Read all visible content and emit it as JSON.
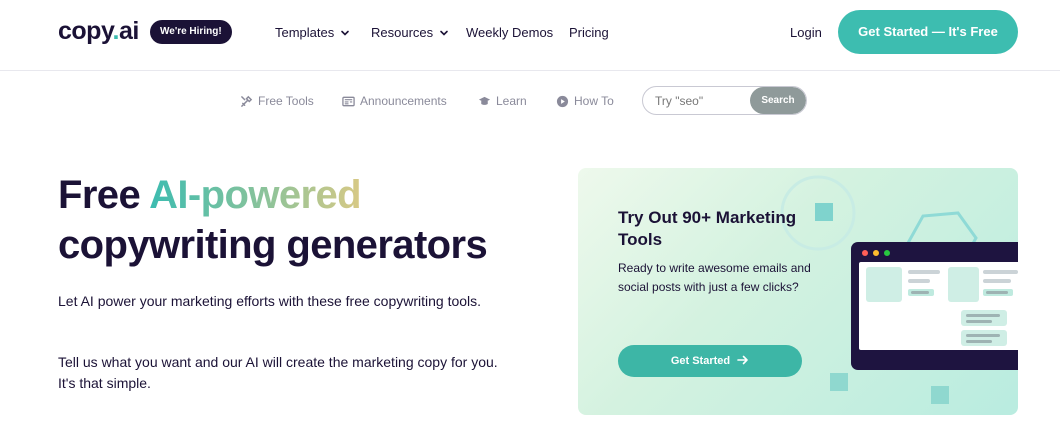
{
  "header": {
    "logo_main": "copy",
    "logo_dot": ".",
    "logo_ai": "ai",
    "hiring_badge": "We're Hiring!",
    "nav": [
      {
        "label": "Templates",
        "has_dropdown": true
      },
      {
        "label": "Resources",
        "has_dropdown": true
      },
      {
        "label": "Weekly Demos",
        "has_dropdown": false
      },
      {
        "label": "Pricing",
        "has_dropdown": false
      }
    ],
    "login_label": "Login",
    "cta_label": "Get Started — It's Free"
  },
  "subnav": {
    "items": [
      {
        "label": "Free Tools",
        "icon": "tools-icon"
      },
      {
        "label": "Announcements",
        "icon": "newspaper-icon"
      },
      {
        "label": "Learn",
        "icon": "graduation-cap-icon"
      },
      {
        "label": "How To",
        "icon": "play-circle-icon"
      }
    ],
    "search": {
      "placeholder": "Try \"seo\"",
      "value": "",
      "button_label": "Search"
    }
  },
  "hero": {
    "title_word1": "Free",
    "title_highlight": "AI-powered",
    "title_line2": "copywriting generators",
    "paragraph1": "Let AI power your marketing efforts with these free copywriting tools.",
    "paragraph2": "Tell us what you want and our AI will create the marketing copy for you. It's that simple."
  },
  "promo": {
    "title": "Try Out 90+ Marketing Tools",
    "description": "Ready to write awesome emails and social posts with just a few clicks?",
    "button_label": "Get Started"
  },
  "colors": {
    "brand_dark": "#1b1236",
    "accent_teal": "#3dbdb0",
    "gradient_end": "#d8c985"
  }
}
